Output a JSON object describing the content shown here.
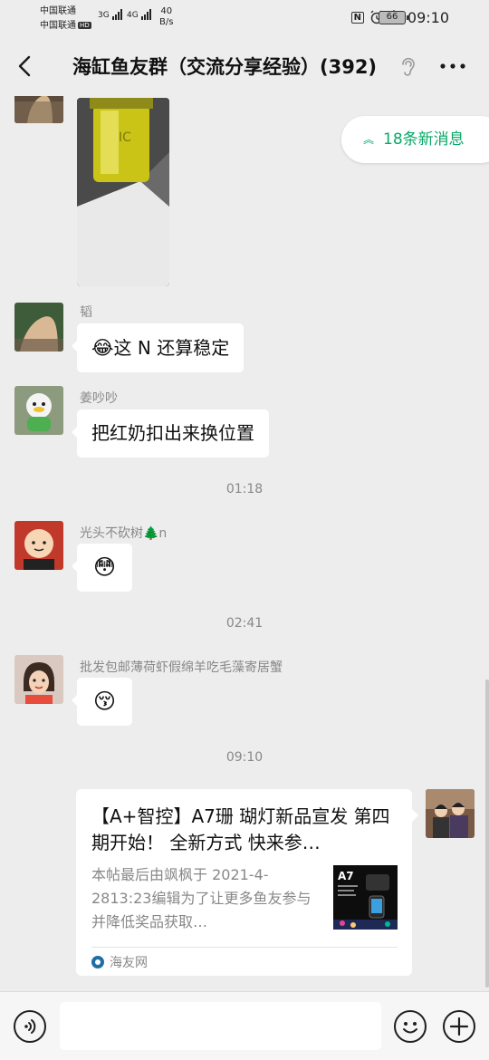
{
  "status_bar": {
    "carrier_1": "中国联通",
    "carrier_2": "中国联通",
    "hd_badge": "HD",
    "net_1": "3G",
    "net_2": "4G",
    "net_speed_value": "40",
    "net_speed_unit": "B/s",
    "nfc_label": "N",
    "battery_level": "66",
    "time": "09:10"
  },
  "header": {
    "title": "海缸鱼友群（交流分享经验）(392)"
  },
  "new_messages": {
    "label": "18条新消息"
  },
  "messages": [
    {
      "type": "image",
      "sender": "",
      "image_label": "IC"
    },
    {
      "type": "text",
      "sender": "韬",
      "emoji": "😂",
      "text": "这 N 还算稳定"
    },
    {
      "type": "text",
      "sender": "姜吵吵",
      "text": "把红奶扣出来换位置"
    },
    {
      "type": "time",
      "text": "01:18"
    },
    {
      "type": "emoji",
      "sender": "光头不砍树🌲n",
      "emoji": "😳"
    },
    {
      "type": "time",
      "text": "02:41"
    },
    {
      "type": "emoji",
      "sender": "批发包邮薄荷虾假绵羊吃毛藻寄居蟹",
      "emoji": "😚"
    },
    {
      "type": "time",
      "text": "09:10"
    },
    {
      "type": "link_card",
      "title": "【A+智控】A7珊 瑚灯新品宣发 第四期开始！ 全新方式  快来参…",
      "description": "本帖最后由飒枫于 2021-4-2813:23编辑为了让更多鱼友参与并降低奖品获取…",
      "thumb_label": "A7",
      "source": "海友网"
    }
  ],
  "input": {
    "placeholder": ""
  },
  "colors": {
    "background": "#ededed",
    "bubble": "#ffffff",
    "accent_green": "#07a868"
  }
}
